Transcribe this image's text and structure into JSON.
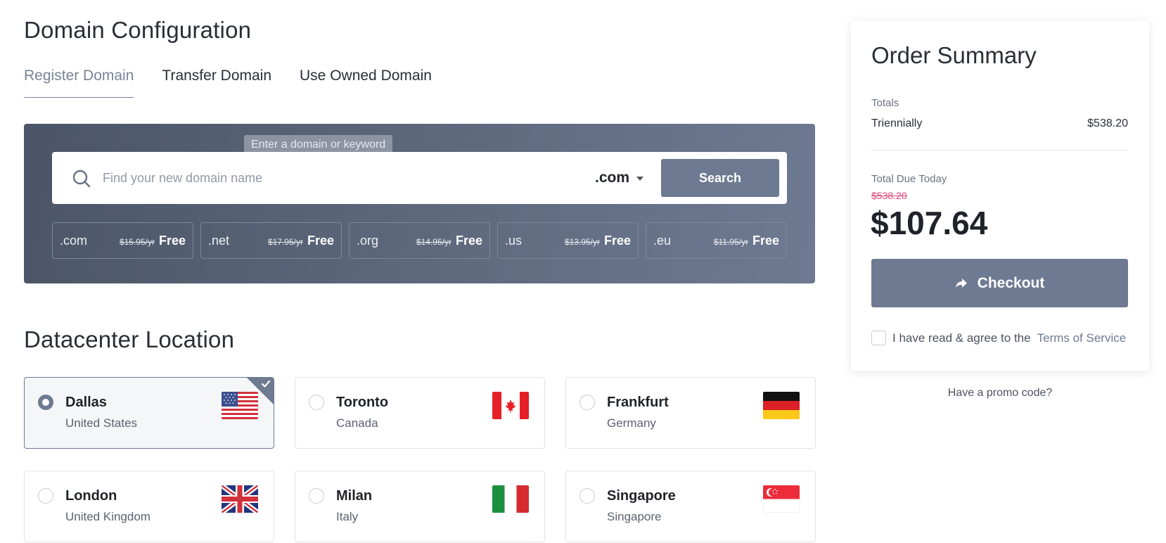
{
  "domain_config": {
    "title": "Domain Configuration",
    "tabs": [
      {
        "label": "Register Domain",
        "active": true
      },
      {
        "label": "Transfer Domain",
        "active": false
      },
      {
        "label": "Use Owned Domain",
        "active": false
      }
    ],
    "search": {
      "tooltip": "Enter a domain or keyword",
      "placeholder": "Find your new domain name",
      "tld": ".com",
      "button_label": "Search"
    },
    "tld_offers": [
      {
        "tld": ".com",
        "old_price": "$15.95/yr",
        "price": "Free"
      },
      {
        "tld": ".net",
        "old_price": "$17.95/yr",
        "price": "Free"
      },
      {
        "tld": ".org",
        "old_price": "$14.95/yr",
        "price": "Free"
      },
      {
        "tld": ".us",
        "old_price": "$13.95/yr",
        "price": "Free"
      },
      {
        "tld": ".eu",
        "old_price": "$11.95/yr",
        "price": "Free"
      }
    ]
  },
  "datacenter": {
    "title": "Datacenter Location",
    "locations": [
      {
        "city": "Dallas",
        "country": "United States",
        "flag": "us-flag-icon",
        "selected": true
      },
      {
        "city": "Toronto",
        "country": "Canada",
        "flag": "ca-flag-icon",
        "selected": false
      },
      {
        "city": "Frankfurt",
        "country": "Germany",
        "flag": "de-flag-icon",
        "selected": false
      },
      {
        "city": "London",
        "country": "United Kingdom",
        "flag": "gb-flag-icon",
        "selected": false
      },
      {
        "city": "Milan",
        "country": "Italy",
        "flag": "it-flag-icon",
        "selected": false
      },
      {
        "city": "Singapore",
        "country": "Singapore",
        "flag": "sg-flag-icon",
        "selected": false
      }
    ]
  },
  "summary": {
    "title": "Order Summary",
    "totals_label": "Totals",
    "cycle_label": "Triennially",
    "cycle_price": "$538.20",
    "due_label": "Total Due Today",
    "due_old": "$538.20",
    "due_price": "$107.64",
    "checkout_label": "Checkout",
    "tos_text": "I have read & agree to the",
    "tos_link": "Terms of Service",
    "promo_label": "Have a promo code?"
  },
  "colors": {
    "accent": "#6e7a92",
    "strike_price": "#e0457b"
  }
}
